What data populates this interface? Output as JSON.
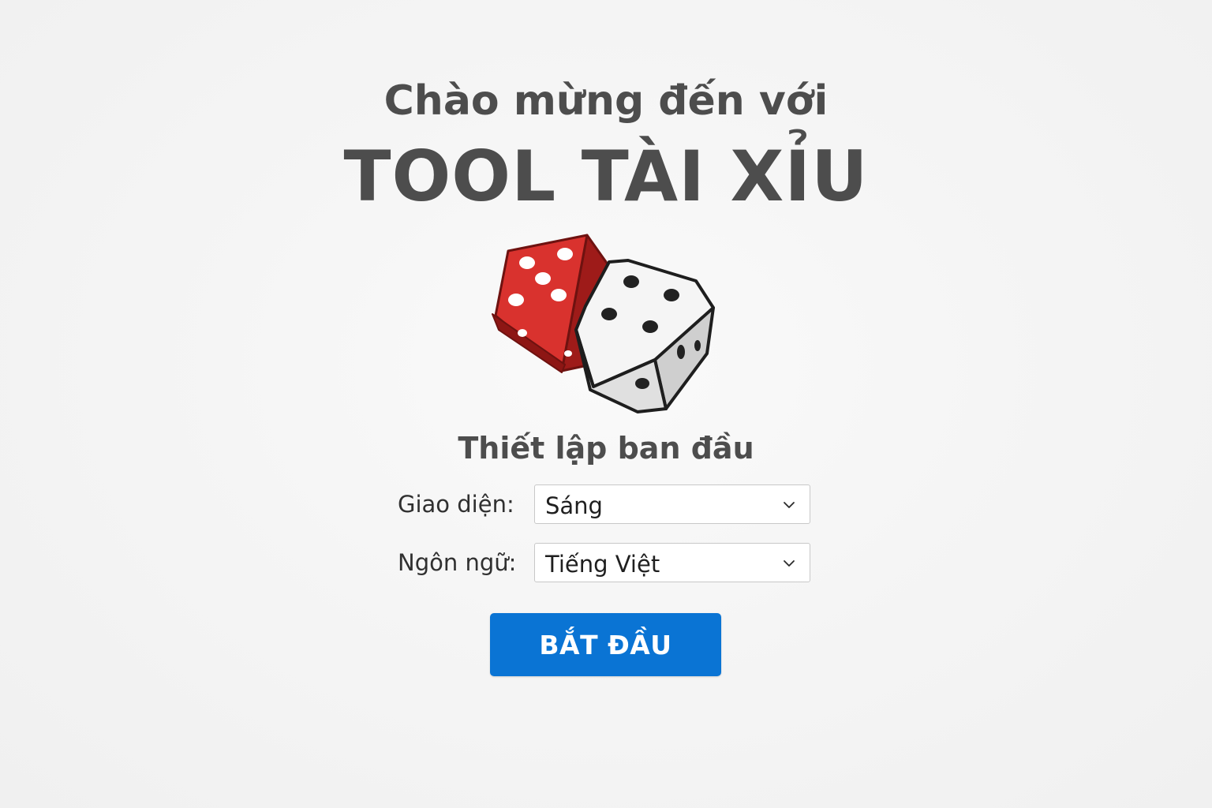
{
  "header": {
    "welcome": "Chào mừng đến với",
    "app_title": "TOOL TÀI XỈU"
  },
  "illustration": {
    "icon": "dice-icon",
    "dice": [
      {
        "name": "red-die",
        "color": "#d9322e"
      },
      {
        "name": "white-die",
        "color": "#f2f2f2"
      }
    ]
  },
  "setup": {
    "title": "Thiết lập ban đầu",
    "theme": {
      "label": "Giao diện:",
      "value": "Sáng"
    },
    "language": {
      "label": "Ngôn ngữ:",
      "value": "Tiếng Việt"
    }
  },
  "actions": {
    "start_label": "BẮT ĐẦU"
  },
  "colors": {
    "background": "#f4f4f4",
    "text": "#4d4d4d",
    "primary_button": "#0a74d4",
    "die_red": "#d9322e",
    "die_white": "#f2f2f2"
  }
}
